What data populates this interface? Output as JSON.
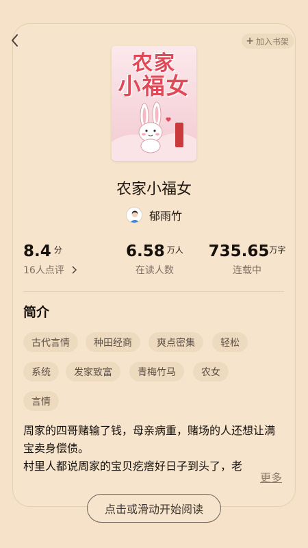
{
  "header": {
    "back_icon": "chevron-left-icon",
    "add_to_shelf_label": "加入书架"
  },
  "book": {
    "cover_title_line1": "农家",
    "cover_title_line2": "小福女",
    "title": "农家小福女",
    "author": "郁雨竹"
  },
  "stats": {
    "score": {
      "value": "8.4",
      "unit": "分",
      "label": "16人点评"
    },
    "readers": {
      "value": "6.58",
      "unit": "万人",
      "label": "在读人数"
    },
    "words": {
      "value": "735.65",
      "unit": "万字",
      "label": "连载中"
    }
  },
  "intro": {
    "heading": "简介",
    "tags": [
      "古代言情",
      "种田经商",
      "爽点密集",
      "轻松",
      "系统",
      "发家致富",
      "青梅竹马",
      "农女",
      "言情"
    ],
    "description": "周家的四哥赌输了钱，母亲病重，赌场的人还想让满宝卖身偿债。\n村里人都说周家的宝贝疙瘩好日子到头了，老",
    "more_label": "更多"
  },
  "footer": {
    "read_button_label": "点击或滑动开始阅读"
  },
  "colors": {
    "background": "#f5e2c9",
    "tag_bg": "#eedbbf",
    "cover_title": "#e04a58"
  }
}
